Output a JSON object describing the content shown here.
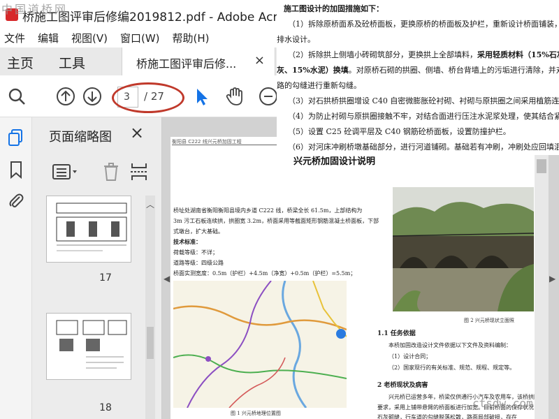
{
  "window": {
    "title": "桥施工图评审后修编2019812.pdf - Adobe Acrobat P",
    "watermark": "中国道桥网"
  },
  "menubar": {
    "items": [
      "文件",
      "编辑",
      "视图(V)",
      "窗口(W)",
      "帮助(H)"
    ]
  },
  "tabs": {
    "home": "主页",
    "tools": "工具",
    "document": "桥施工图评审后修...",
    "close": "×"
  },
  "toolbar": {
    "current_page": "3",
    "total_pages": "/ 27",
    "icons": [
      "search-icon",
      "page-up-icon",
      "page-down-icon",
      "select-arrow-icon",
      "hand-icon",
      "zoom-out-icon"
    ]
  },
  "sidebar": {
    "title": "页面缩略图",
    "close": "×",
    "thumbnails": [
      {
        "label": "17"
      },
      {
        "label": "18"
      }
    ]
  },
  "overlay_text": {
    "heading": "施工图设计的加固措施如下：",
    "lines": [
      "（1）拆除原桥面系及砼桥面板，更换原桥的桥面板及护栏，重新设计桥面铺装，增",
      "排水设计。",
      "（2）拆除拱上侧墙小砖砌筑部分，更换拱上全部填料，",
      "采用轻质材料（15%石灰、",
      "灰、15%水泥）换填",
      "。对原桥石砌的拱圈、侧墙、桥台背墙上的污垢进行清除，并对桥",
      "路的勾缝进行重新勾缝。",
      "（3）对石拱桥拱圈增设 C40 自密微膨胀砼衬砌、衬砌与原拱圈之间采用植筋连接。",
      "（4）为防止衬砌与原拱圈接触不牢，对结合面进行压注水泥浆处理，使其结合紧密",
      "（5）设置 C25 砼调平层及 C40 钢筋砼桥面板，设置防撞护栏。",
      "（6）对河床冲刷桥墩基础部分，进行河道铺砌。基础若有冲刷，冲刷处应回填混凝"
    ]
  },
  "document": {
    "header": "衡阳县 C222 线兴元桥加固工程",
    "heading": "兴元桥加固设计说明",
    "left_lines": [
      "桥址处湖南省衡阳衡阳县境内乡道 C222 线，桥梁全长 61.5m，上部结构为",
      "3m 污工石板连续拱，拱圈宽 3.2m，桥面采用等截面矩形钢筋混凝土桥面板，下部",
      "式墩台，扩大基础。",
      "技术标准：",
      "荷载等级：不详；",
      "道路等级：四级公路",
      "桥面实测宽度：0.5m（护栏）+4.5m（净宽）+0.5m（护栏）=5.5m；"
    ],
    "map_caption": "图 1  兴元桥地理位置图",
    "photo_caption": "图 2  兴元桥现状立面照",
    "section1_title": "1.1 任务依据",
    "section1_lines": [
      "本桥加固改造设计文件依据以下文件及资料编制：",
      "（1）设计合同；",
      "（2）国家现行的有关标准、规范、规程、规定等。"
    ],
    "section2_title": "2 老桥现状及病害",
    "section2_lines": [
      "兴元桥已运营多年，桥梁仅供通行小汽车及农用车，该桥拱圈为",
      "要求，采用上铺带悬臂的桥面板进行加宽。目前桥面的保存状况",
      "石灰砌缝，行车道的勾缝脱落松散，路面局部破损，存在"
    ]
  },
  "corner_watermark": "ctsdw.com",
  "colors": {
    "annotation": "#c0392b",
    "accent_blue": "#1473e6",
    "acrobat_red": "#d7282a"
  }
}
